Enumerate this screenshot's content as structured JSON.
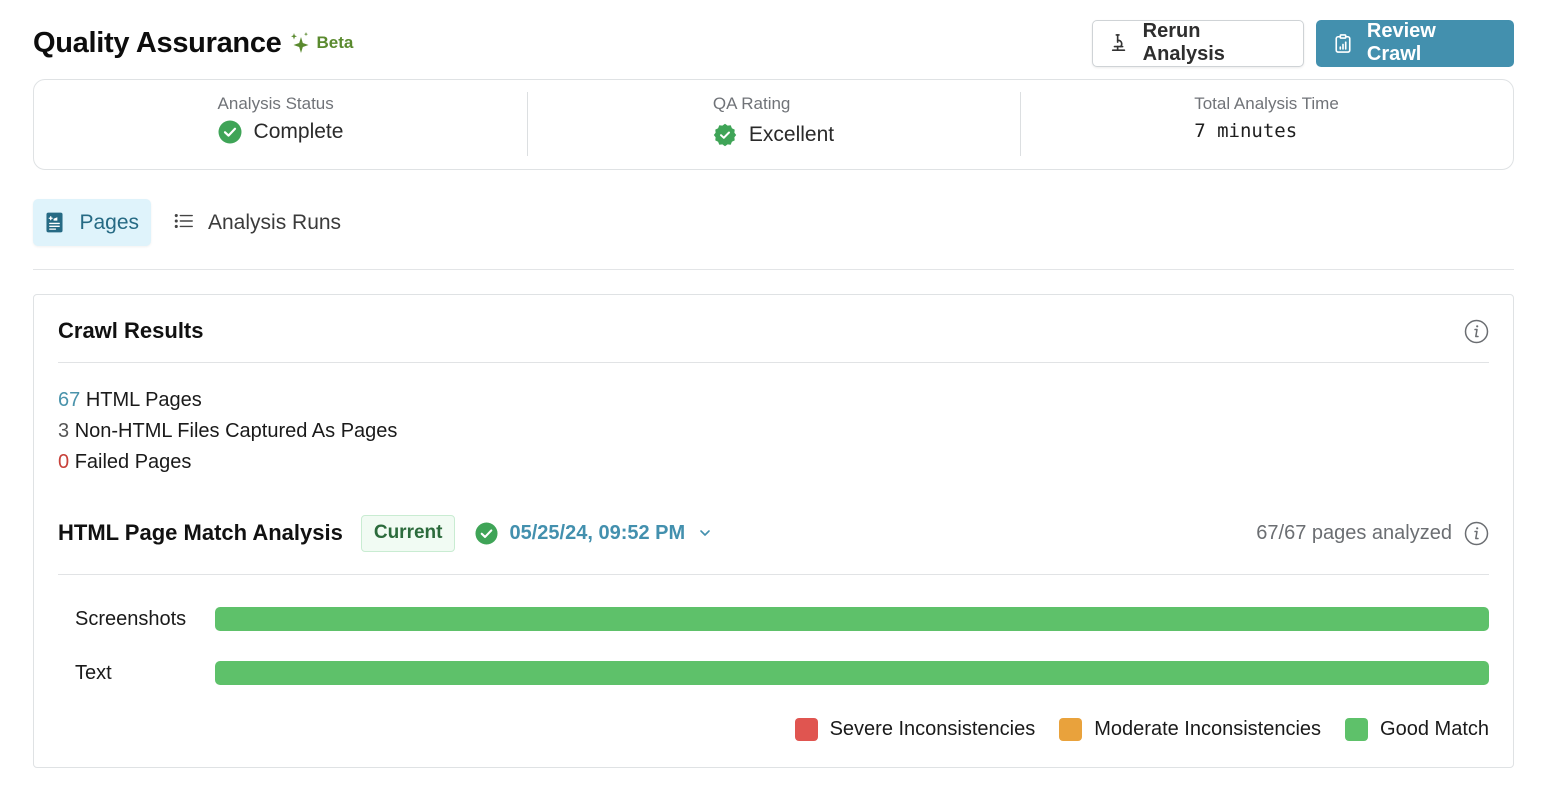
{
  "header": {
    "title": "Quality Assurance",
    "beta_label": "Beta",
    "rerun_button": "Rerun Analysis",
    "review_button": "Review Crawl"
  },
  "stats": [
    {
      "label": "Analysis Status",
      "value": "Complete",
      "icon": "check-circle-icon"
    },
    {
      "label": "QA Rating",
      "value": "Excellent",
      "icon": "badge-check-icon"
    },
    {
      "label": "Total Analysis Time",
      "value": "7 minutes"
    }
  ],
  "tabs": [
    {
      "label": "Pages",
      "icon": "document-icon",
      "active": true
    },
    {
      "label": "Analysis Runs",
      "icon": "list-icon",
      "active": false
    }
  ],
  "crawl_results": {
    "title": "Crawl Results",
    "items": [
      {
        "count": "67",
        "label": "HTML Pages"
      },
      {
        "count": "3",
        "label": "Non-HTML Files Captured As Pages"
      },
      {
        "count": "0",
        "label": "Failed Pages"
      }
    ]
  },
  "match_analysis": {
    "title": "HTML Page Match Analysis",
    "badge": "Current",
    "run_date": "05/25/24, 09:52 PM",
    "pages_analyzed": "67/67 pages analyzed",
    "bars": [
      {
        "label": "Screenshots",
        "severe": 0,
        "moderate": 0,
        "good": 100
      },
      {
        "label": "Text",
        "severe": 0,
        "moderate": 0,
        "good": 100
      }
    ],
    "legend": [
      {
        "label": "Severe Inconsistencies",
        "color": "#e05550"
      },
      {
        "label": "Moderate Inconsistencies",
        "color": "#e9a23c"
      },
      {
        "label": "Good Match",
        "color": "#5ec16a"
      }
    ]
  },
  "colors": {
    "accent": "#4390ae",
    "success": "#3fa457",
    "beta": "#5a8a2e"
  }
}
